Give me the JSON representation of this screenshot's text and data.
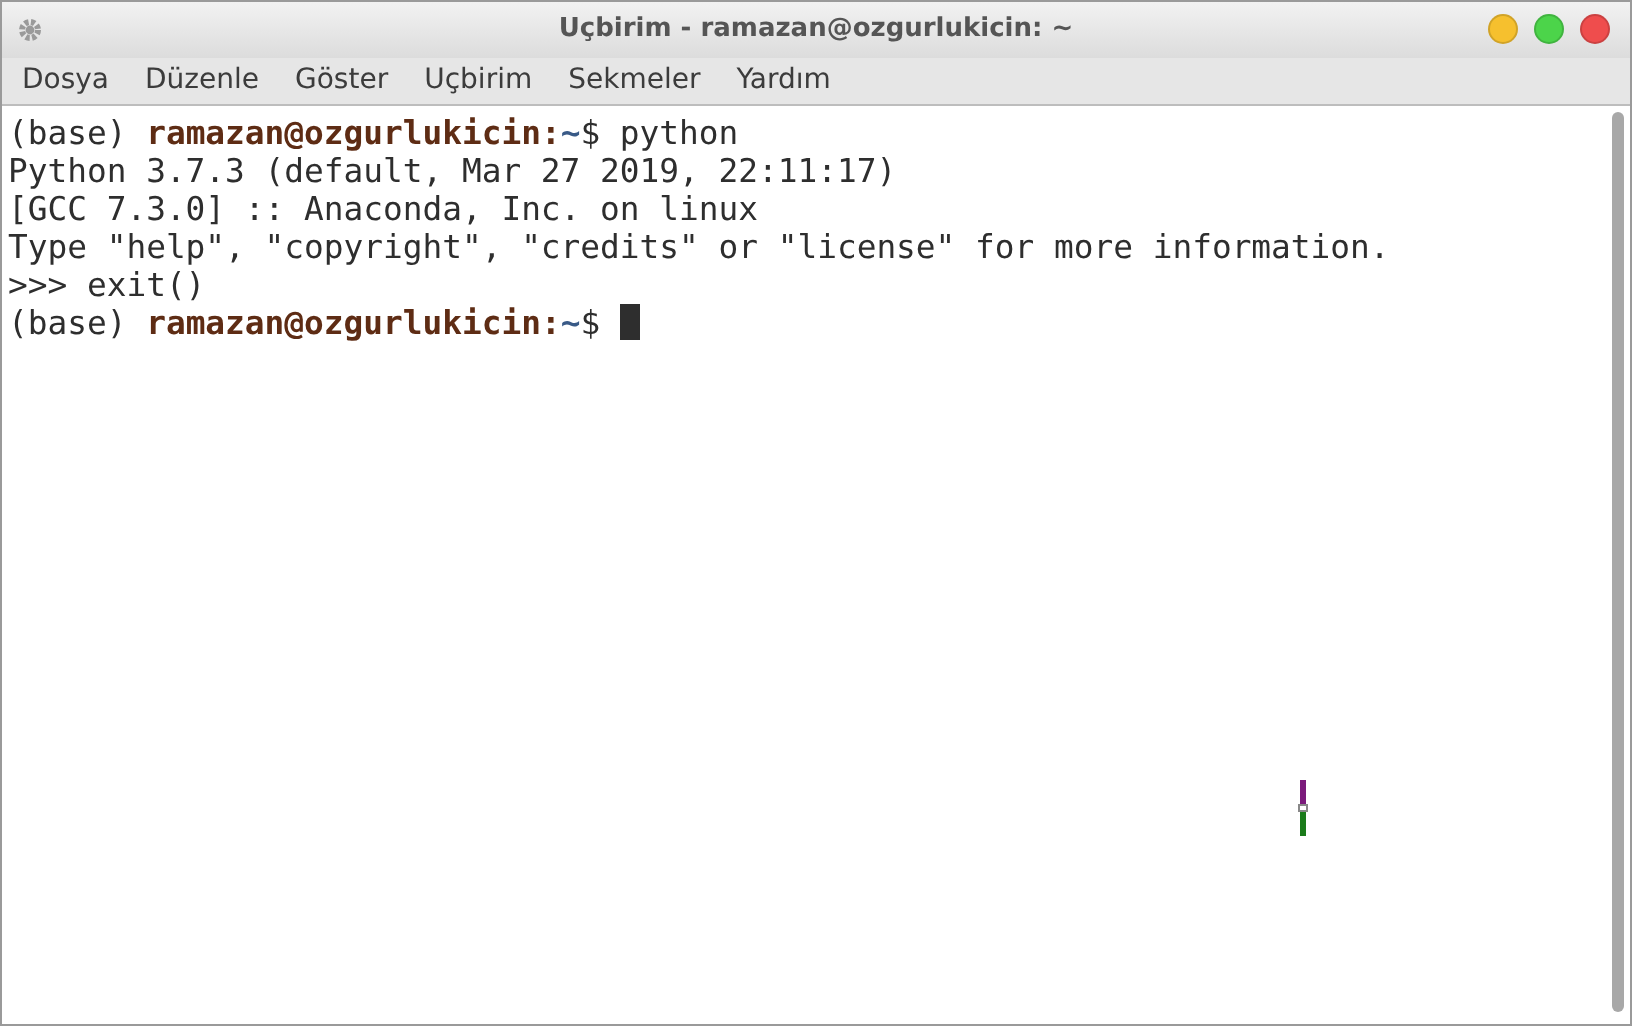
{
  "window": {
    "title": "Uçbirim - ramazan@ozgurlukicin: ~"
  },
  "menu": [
    "Dosya",
    "Düzenle",
    "Göster",
    "Uçbirim",
    "Sekmeler",
    "Yardım"
  ],
  "terminal": {
    "lines": [
      {
        "segments": [
          {
            "kind": "plain",
            "text": "(base) "
          },
          {
            "kind": "user",
            "text": "ramazan@ozgurlukicin:"
          },
          {
            "kind": "path",
            "text": "~"
          },
          {
            "kind": "plain",
            "text": "$ python"
          }
        ]
      },
      {
        "segments": [
          {
            "kind": "plain",
            "text": "Python 3.7.3 (default, Mar 27 2019, 22:11:17)"
          }
        ]
      },
      {
        "segments": [
          {
            "kind": "plain",
            "text": "[GCC 7.3.0] :: Anaconda, Inc. on linux"
          }
        ]
      },
      {
        "segments": [
          {
            "kind": "plain",
            "text": "Type \"help\", \"copyright\", \"credits\" or \"license\" for more information."
          }
        ]
      },
      {
        "segments": [
          {
            "kind": "plain",
            "text": ">>> exit()"
          }
        ]
      },
      {
        "segments": [
          {
            "kind": "plain",
            "text": "(base) "
          },
          {
            "kind": "user",
            "text": "ramazan@ozgurlukicin:"
          },
          {
            "kind": "path",
            "text": "~"
          },
          {
            "kind": "plain",
            "text": "$ "
          }
        ],
        "cursor": true
      }
    ]
  }
}
